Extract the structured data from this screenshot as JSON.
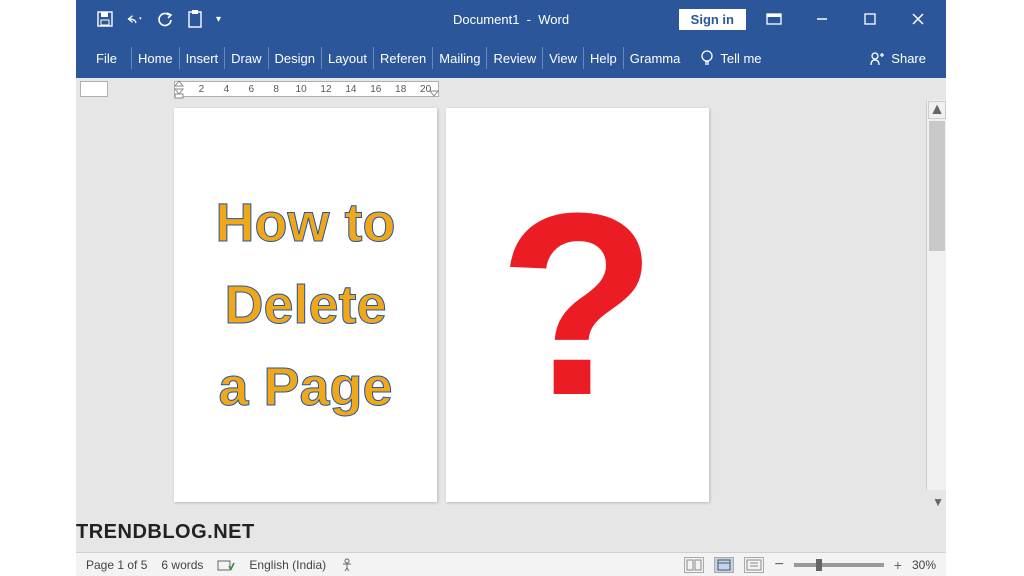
{
  "titlebar": {
    "document_title": "Document1",
    "app_name": "Word",
    "signin": "Sign in"
  },
  "tabs": {
    "file": "File",
    "home": "Home",
    "insert": "Insert",
    "draw": "Draw",
    "design": "Design",
    "layout": "Layout",
    "references": "Referen",
    "mailings": "Mailing",
    "review": "Review",
    "view": "View",
    "help": "Help",
    "grammar": "Gramma",
    "tellme": "Tell me",
    "share": "Share"
  },
  "ruler": [
    "2",
    "4",
    "6",
    "8",
    "10",
    "12",
    "14",
    "16",
    "18",
    "20"
  ],
  "document": {
    "line1": "How to",
    "line2": "Delete",
    "line3": "a Page",
    "page2_glyph": "?"
  },
  "statusbar": {
    "page": "Page 1 of 5",
    "words": "6 words",
    "language": "English (India)",
    "zoom": "30%"
  },
  "watermark": "TRENDBLOG.NET"
}
